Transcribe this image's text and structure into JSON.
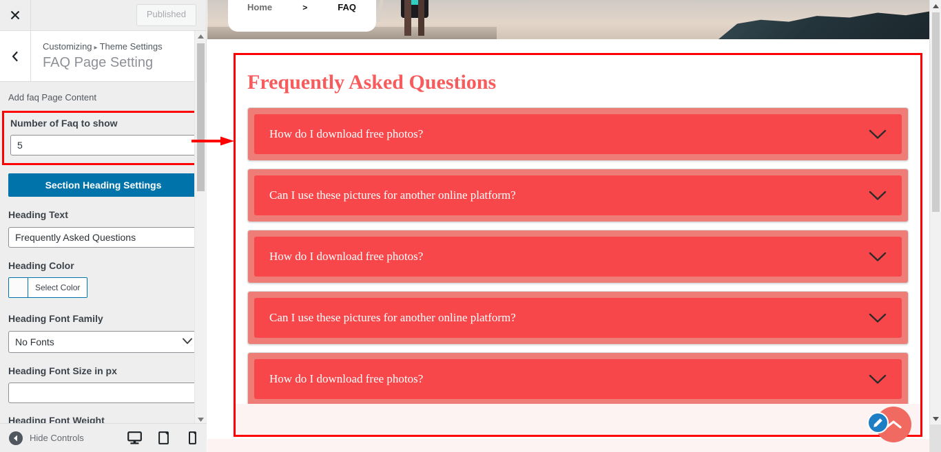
{
  "customizer": {
    "close_icon": "close-icon",
    "publish_label": "Published",
    "back_icon": "chevron-left-icon",
    "breadcrumb_root": "Customizing",
    "breadcrumb_sep": "▸",
    "breadcrumb_parent": "Theme Settings",
    "page_title": "FAQ Page Setting",
    "description": "Add faq Page Content",
    "fields": {
      "faq_count": {
        "label": "Number of Faq to show",
        "value": "5",
        "placeholder": ""
      },
      "section_heading_button": "Section Heading Settings",
      "heading_text": {
        "label": "Heading Text",
        "value": "Frequently Asked Questions",
        "placeholder": ""
      },
      "heading_color": {
        "label": "Heading Color",
        "button": "Select Color",
        "swatch": "#fbfbfb"
      },
      "heading_font_family": {
        "label": "Heading Font Family",
        "value": "No Fonts",
        "options": [
          "No Fonts"
        ]
      },
      "heading_font_size": {
        "label": "Heading Font Size in px",
        "value": "",
        "placeholder": ""
      },
      "heading_font_weight": {
        "label": "Heading Font Weight"
      }
    },
    "footer": {
      "hide_controls": "Hide Controls",
      "devices": [
        {
          "name": "desktop",
          "icon": "desktop-icon",
          "active": true
        },
        {
          "name": "tablet",
          "icon": "tablet-icon",
          "active": false
        },
        {
          "name": "mobile",
          "icon": "mobile-icon",
          "active": false
        }
      ]
    }
  },
  "preview": {
    "breadcrumb": {
      "home": "Home",
      "separator": ">",
      "current": "FAQ"
    },
    "heading": "Frequently Asked Questions",
    "heading_color": "#f85b5b",
    "accordion_color": "#f8474a",
    "accordion_wrap_color": "#ef7d77",
    "faqs": [
      {
        "question": "How do I download free photos?",
        "icon": "chevron-down-icon"
      },
      {
        "question": "Can I use these pictures for another online platform?",
        "icon": "chevron-down-icon"
      },
      {
        "question": "How do I download free photos?",
        "icon": "chevron-down-icon"
      },
      {
        "question": "Can I use these pictures for another online platform?",
        "icon": "chevron-down-icon"
      },
      {
        "question": "How do I download free photos?",
        "icon": "chevron-down-icon"
      }
    ],
    "floating": {
      "edit_icon": "pencil-icon",
      "to_top_icon": "chevron-up-icon"
    }
  },
  "annotations": {
    "highlight_color": "#ff0000",
    "arrow": "right-arrow"
  }
}
